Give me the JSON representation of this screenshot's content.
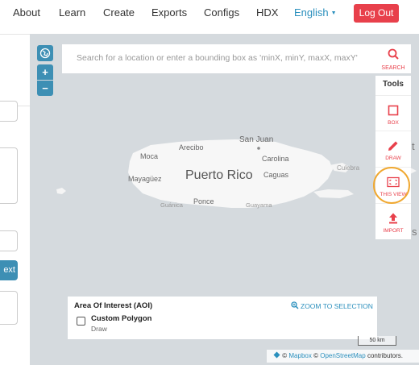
{
  "nav": {
    "about": "About",
    "learn": "Learn",
    "create": "Create",
    "exports": "Exports",
    "configs": "Configs",
    "hdx": "HDX",
    "language": "English",
    "logout": "Log Out"
  },
  "left_panel": {
    "next_label": "ext"
  },
  "map": {
    "search": {
      "placeholder": "Search for a location or enter a bounding box as 'minX, minY, maxX, maxY'",
      "button_label": "SEARCH"
    },
    "zoom": {
      "in": "+",
      "out": "−"
    },
    "places": {
      "main": "Puerto Rico",
      "san_juan": "San Juan",
      "arecibo": "Arecibo",
      "moca": "Moca",
      "carolina": "Carolina",
      "mayaguez": "Mayagüez",
      "caguas": "Caguas",
      "culebra": "Culebra",
      "ponce": "Ponce",
      "guanica": "Guánica",
      "guayama": "Guayama"
    },
    "tools": {
      "title": "Tools",
      "items": [
        {
          "label": "BOX",
          "icon": "square-icon"
        },
        {
          "label": "DRAW",
          "icon": "pencil-icon"
        },
        {
          "label": "THIS VIEW",
          "icon": "frame-icon"
        },
        {
          "label": "IMPORT",
          "icon": "upload-icon"
        }
      ]
    },
    "aoi": {
      "title": "Area Of Interest (AOI)",
      "zoom_label": "ZOOM TO SELECTION",
      "item_name": "Custom Polygon",
      "item_type": "Draw"
    },
    "scale": "50 km",
    "attribution": {
      "copy1": "©",
      "mapbox": "Mapbox",
      "copy2": "©",
      "osm": "OpenStreetMap",
      "suffix": "contributors."
    },
    "edge_text": {
      "t": "t",
      "s": "s"
    }
  },
  "colors": {
    "accent": "#e8404b",
    "link": "#2a8fbd",
    "control": "#3d8fb4",
    "highlight": "#f0a830"
  }
}
